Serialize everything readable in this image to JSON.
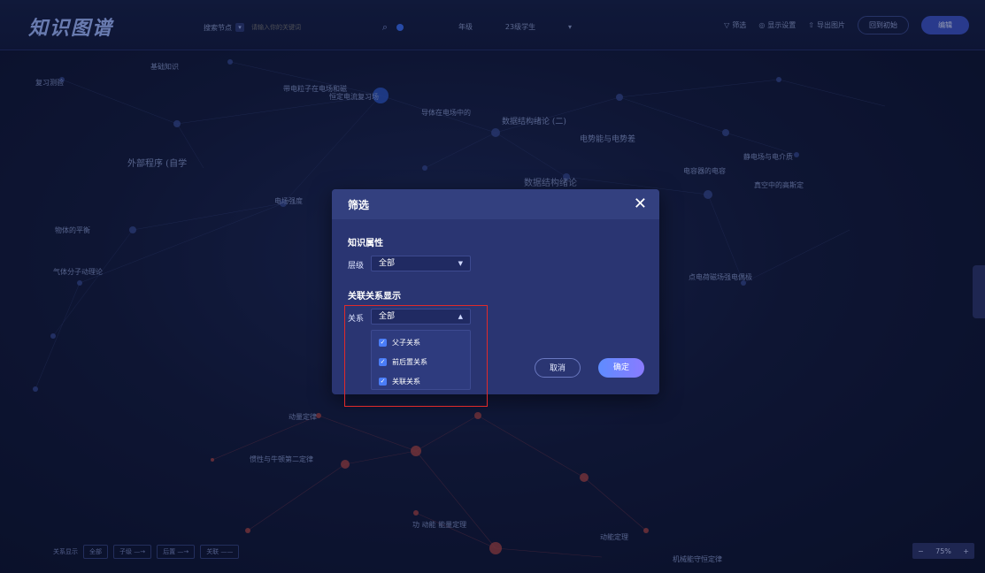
{
  "app": {
    "logo": "知识图谱"
  },
  "topbar": {
    "search_type": "搜索节点",
    "search_placeholder": "请输入你的关键词",
    "grade_label": "年级",
    "grade_value": "23级学生",
    "actions": {
      "filter": "筛选",
      "display_settings": "显示设置",
      "export": "导出图片",
      "reset": "回到初始",
      "edit": "编辑"
    }
  },
  "modal": {
    "title": "筛选",
    "section_attr": "知识属性",
    "level_label": "层级",
    "level_value": "全部",
    "section_relation": "关联关系显示",
    "relation_label": "关系",
    "relation_value": "全部",
    "options": [
      {
        "label": "父子关系",
        "checked": true
      },
      {
        "label": "前后置关系",
        "checked": true
      },
      {
        "label": "关联关系",
        "checked": true
      }
    ],
    "cancel": "取消",
    "ok": "确定"
  },
  "legend": {
    "title": "关系显示",
    "items": [
      "全部",
      "子级 —→",
      "后置 —→",
      "关联 ——"
    ]
  },
  "zoom": {
    "minus": "−",
    "value": "75%",
    "plus": "+"
  },
  "graph_labels": [
    "基础知识",
    "复习测验",
    "外部程序 (自学",
    "带电粒子在电场和磁",
    "恒定电流复习场",
    "导体在电场中的",
    "数据结构绪论 (二)",
    "电势能与电势差",
    "数据结构绪论",
    "点电荷磁场强电偶极",
    "物体的平衡",
    "动量定律",
    "惯性与牛顿第二定律",
    "机械能守恒定律",
    "动能定理",
    "电容器的电容",
    "静电场与电介质",
    "真空中的高斯定",
    "气体分子动理论",
    "电场强度",
    "功 动能 能量定理"
  ],
  "colors": {
    "accent": "#3c55c8",
    "highlight_box": "#e02a2a",
    "checkbox": "#4a7df7"
  }
}
